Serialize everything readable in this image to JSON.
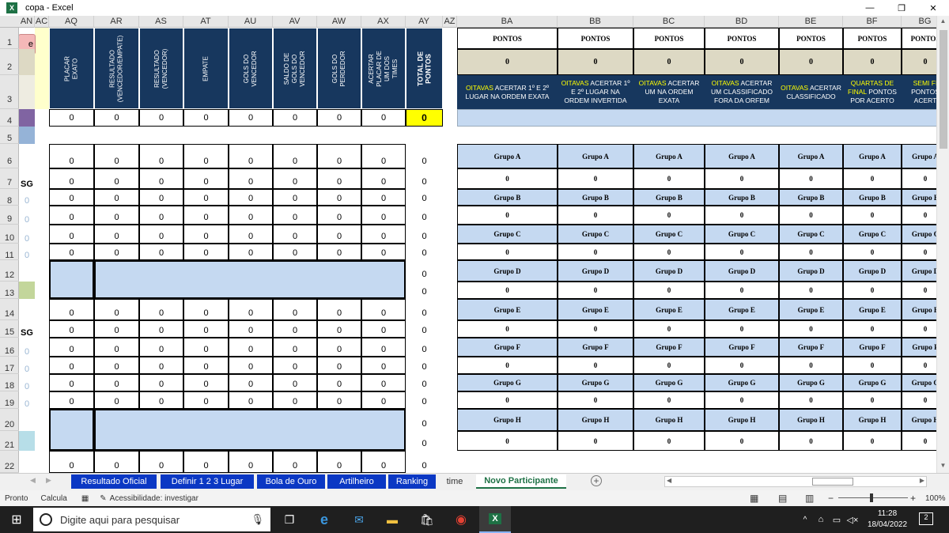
{
  "app": {
    "title": "copa - Excel",
    "icon": "excel-icon"
  },
  "window": {
    "minimize": "—",
    "restore": "❐",
    "close": "✕"
  },
  "columns": [
    "AN",
    "AC",
    "AQ",
    "AR",
    "AS",
    "AT",
    "AU",
    "AV",
    "AW",
    "AX",
    "AY",
    "AZ",
    "BA",
    "BB",
    "BC",
    "BD",
    "BE",
    "BF",
    "BG"
  ],
  "rows": [
    "1",
    "2",
    "3",
    "4",
    "5",
    "6",
    "7",
    "8",
    "9",
    "10",
    "11",
    "12",
    "13",
    "14",
    "15",
    "16",
    "17",
    "18",
    "19",
    "20",
    "21",
    "22"
  ],
  "left_headers": [
    "PLACAR EXATO",
    "RESULTADO (VENCEDOR/EMPATE)",
    "RESULTADO (VENCEDOR)",
    "EMPATE",
    "GOLS DO VENCEDOR",
    "SALDO DE GOLS DO VENCEDOR",
    "GOLS DO PERDEDOR",
    "ACERTAR PLACAR DE UM DOS TIMES",
    "TOTAL DE PONTOS"
  ],
  "zero": "0",
  "total_value": "0",
  "sg_label": "SG",
  "left_button": "e",
  "pontos_label": "PONTOS",
  "descs": [
    {
      "hl": "OITAVAS",
      "rest": " ACERTAR 1º E 2º LUGAR NA ORDEM EXATA"
    },
    {
      "hl": "OITAVAS",
      "rest": " ACERTAR 1º E 2º LUGAR NA ORDEM INVERTIDA"
    },
    {
      "hl": "OITAVAS",
      "rest": " ACERTAR UM NA ORDEM EXATA"
    },
    {
      "hl": "OITAVAS",
      "rest": " ACERTAR UM CLASSIFICADO FORA DA ORFEM"
    },
    {
      "hl": "OITAVAS",
      "rest": " ACERTAR CLASSIFICADO"
    },
    {
      "hl": "QUARTAS DE FINAL",
      "rest": " PONTOS POR ACERTO"
    },
    {
      "hl": "SEMI FI",
      "rest": " PONTOS ACERT"
    }
  ],
  "groups": [
    "Grupo A",
    "Grupo B",
    "Grupo C",
    "Grupo D",
    "Grupo E",
    "Grupo F",
    "Grupo G",
    "Grupo H"
  ],
  "sheets": [
    "Resultado Oficial",
    "Definir 1 2 3 Lugar",
    "Bola de Ouro",
    "Artilheiro",
    "Ranking",
    "time",
    "Novo Participante"
  ],
  "status": {
    "mode": "Pronto",
    "calc": "Calcula",
    "access": "Acessibilidade: investigar",
    "zoom": "100%"
  },
  "taskbar": {
    "search": "Digite aqui para pesquisar",
    "time": "11:28",
    "date": "18/04/2022",
    "notif": "2"
  }
}
